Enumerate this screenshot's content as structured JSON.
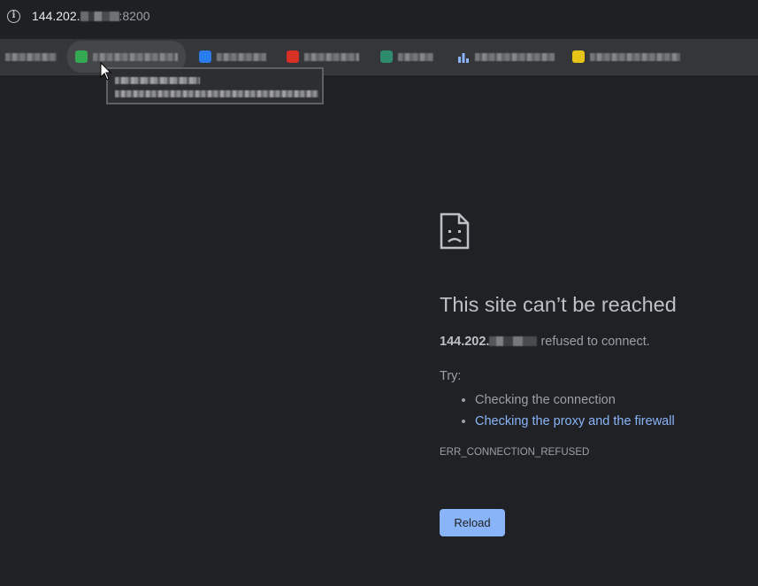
{
  "address_bar": {
    "url_prefix": "144.202.",
    "url_suffix": ":8200",
    "info_icon": "info-icon"
  },
  "bookmarks": {
    "items": [
      {
        "icon": "none",
        "color": "#35363a"
      },
      {
        "icon": "green-favicon",
        "color": "#34a853"
      },
      {
        "icon": "blue-favicon",
        "color": "#2b7de9"
      },
      {
        "icon": "red-favicon",
        "color": "#d93025"
      },
      {
        "icon": "teal-favicon",
        "color": "#2e8b6b"
      },
      {
        "icon": "bar-chart-favicon",
        "color": "#8ab4f8"
      },
      {
        "icon": "yellow-favicon",
        "color": "#e6c417"
      }
    ]
  },
  "error": {
    "icon": "sad-page-icon",
    "title": "This site can’t be reached",
    "host": "144.202.",
    "message_suffix": "refused to connect.",
    "try_label": "Try:",
    "suggestions": [
      {
        "text": "Checking the connection",
        "is_link": false
      },
      {
        "text": "Checking the proxy and the firewall",
        "is_link": true
      }
    ],
    "error_code": "ERR_CONNECTION_REFUSED",
    "reload_label": "Reload"
  },
  "colors": {
    "background": "#202124",
    "link": "#8ab4f8",
    "button": "#8ab4f8",
    "title": "#bdc1c6",
    "text": "#9aa0a6"
  }
}
